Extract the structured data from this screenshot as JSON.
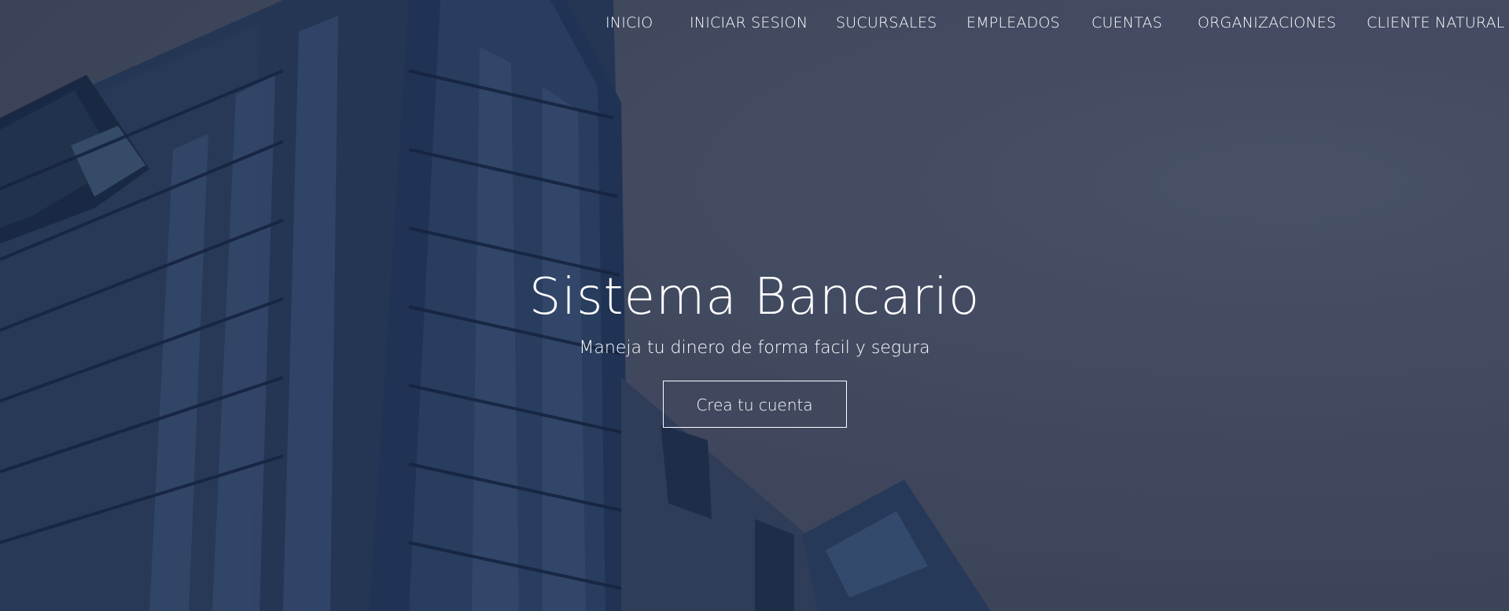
{
  "nav": {
    "items": [
      {
        "label": "INICIO"
      },
      {
        "label": "INICIAR SESION"
      },
      {
        "label": "SUCURSALES"
      },
      {
        "label": "EMPLEADOS"
      },
      {
        "label": "CUENTAS"
      },
      {
        "label": "ORGANIZACIONES"
      },
      {
        "label": "CLIENTE NATURAL"
      }
    ]
  },
  "hero": {
    "title": "Sistema Bancario",
    "subtitle": "Maneja tu dinero de forma facil y segura",
    "cta_label": "Crea tu cuenta"
  },
  "colors": {
    "text": "#ffffff",
    "background": "#454c60",
    "building": "#1f3352"
  }
}
